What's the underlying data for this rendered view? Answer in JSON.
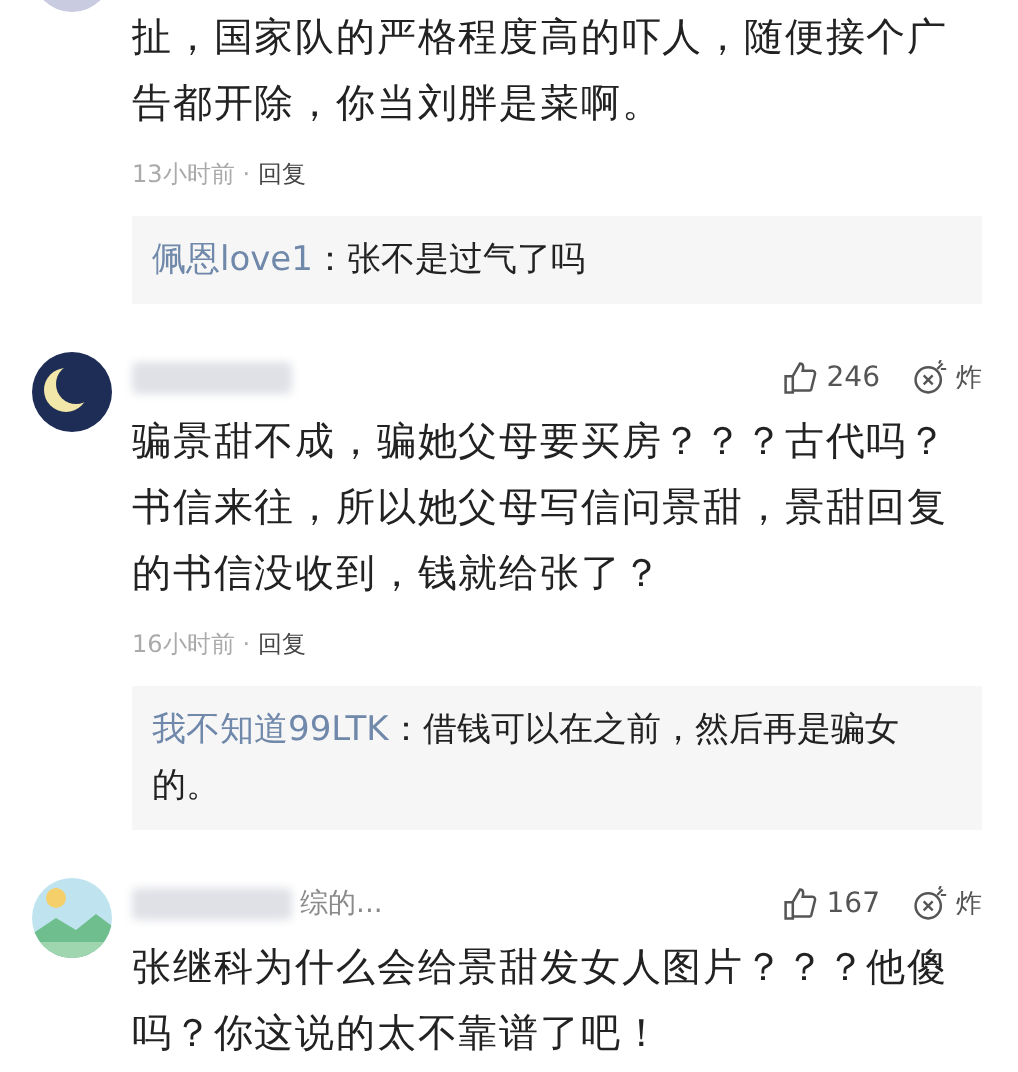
{
  "comments": [
    {
      "kind": "partial",
      "text": "扯，国家队的严格程度高的吓人，随便接个广告都开除，你当刘胖是菜啊。",
      "time": "13小时前",
      "separator": "·",
      "reply_label": "回复",
      "replies": [
        {
          "user": "佩恩love1",
          "colon": "：",
          "text": "张不是过气了吗"
        }
      ]
    },
    {
      "kind": "moon",
      "name_blurred": true,
      "likes": "246",
      "bomb": "炸",
      "text": "骗景甜不成，骗她父母要买房？？？古代吗？书信来往，所以她父母写信问景甜，景甜回复的书信没收到，钱就给张了？",
      "time": "16小时前",
      "separator": "·",
      "reply_label": "回复",
      "replies": [
        {
          "user": "我不知道99LTK",
          "colon": "：",
          "text": "借钱可以在之前，然后再是骗女的。"
        }
      ]
    },
    {
      "kind": "landscape",
      "name_blurred": true,
      "name_tail": "综的...",
      "likes": "167",
      "bomb": "炸",
      "text": "张继科为什么会给景甜发女人图片？？？他傻吗？你这说的太不靠谱了吧！"
    }
  ]
}
